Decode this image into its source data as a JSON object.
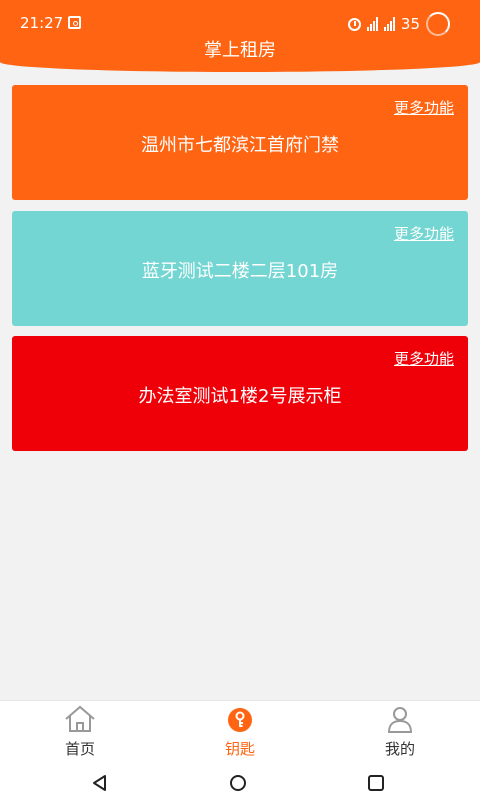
{
  "status_bar": {
    "time": "21:27",
    "battery": "35"
  },
  "header": {
    "title": "掌上租房"
  },
  "cards": [
    {
      "title": "温州市七都滨江首府门禁",
      "more_label": "更多功能",
      "color": "#ff6412"
    },
    {
      "title": "蓝牙测试二楼二层101房",
      "more_label": "更多功能",
      "color": "#74d6d3"
    },
    {
      "title": "办法室测试1楼2号展示柜",
      "more_label": "更多功能",
      "color": "#ef0008"
    }
  ],
  "bottom_nav": {
    "items": [
      {
        "label": "首页",
        "icon": "home-icon",
        "active": false
      },
      {
        "label": "钥匙",
        "icon": "key-icon",
        "active": true
      },
      {
        "label": "我的",
        "icon": "user-icon",
        "active": false
      }
    ],
    "active_color": "#ff6412"
  },
  "system_nav": {
    "buttons": [
      "back-icon",
      "home-circle-icon",
      "recents-icon"
    ]
  }
}
